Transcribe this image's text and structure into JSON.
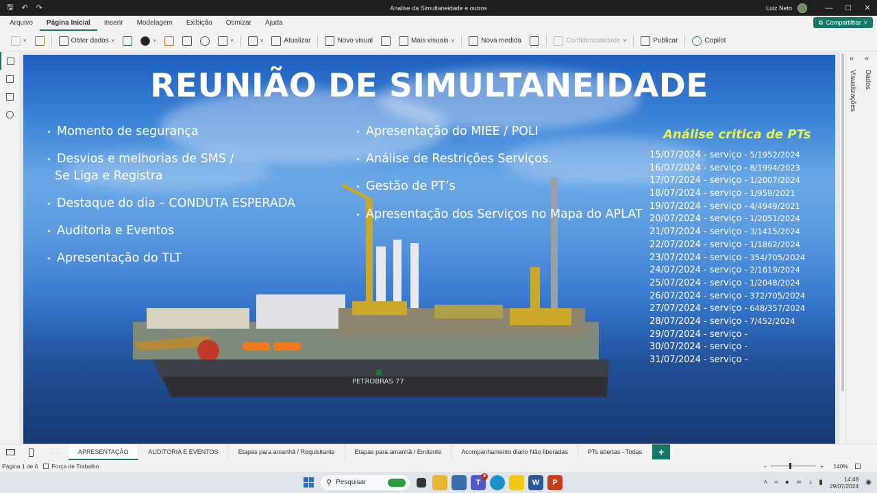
{
  "window": {
    "title": "Analise da Simultaneidade e outros",
    "user": "Luiz Neto",
    "controls": [
      "—",
      "☐",
      "✕"
    ]
  },
  "ribbon": {
    "tabs": [
      "Arquivo",
      "Página Inicial",
      "Inserir",
      "Modelagem",
      "Exibição",
      "Otimizar",
      "Ajuda"
    ],
    "active_tab": "Página Inicial",
    "share_label": "Compartilhar"
  },
  "toolbar": {
    "get_data": "Obter dados",
    "refresh": "Atualizar",
    "new_visual": "Novo visual",
    "more_visuals": "Mais visuais",
    "new_measure": "Nova medida",
    "sensitivity": "Confidencialidade",
    "publish": "Publicar",
    "copilot": "Copilot"
  },
  "right_panes": {
    "visualizations": "Visualizações",
    "data": "Dados"
  },
  "slide": {
    "title": "REUNIÃO DE SIMULTANEIDADE",
    "left_agenda": [
      "Momento de segurança",
      "Desvios e melhorias de SMS /",
      "Se Liga e Registra",
      "Destaque do dia – CONDUTA ESPERADA",
      "Auditoria e Eventos",
      "Apresentação do TLT"
    ],
    "middle_agenda": [
      "Apresentação do MIEE / POLI",
      "Análise de Restrições Serviços.",
      "Gestão de PT’s",
      "Apresentação dos Serviços no Mapa do APLAT"
    ],
    "pts_title": "Análise critica de PTs",
    "pts": [
      {
        "date": "15/07/2024 - serviço -",
        "num": "5/1952/2024"
      },
      {
        "date": "16/07/2024 - serviço -",
        "num": "8/1994/2023"
      },
      {
        "date": "17/07/2024 - serviço -",
        "num": "1/2007/2024"
      },
      {
        "date": "18/07/2024 - serviço -",
        "num": "1/959/2021"
      },
      {
        "date": "19/07/2024 - serviço -",
        "num": "4/4949/2021"
      },
      {
        "date": "20/07/2024 - serviço -",
        "num": "1/2051/2024"
      },
      {
        "date": "21/07/2024 - serviço -",
        "num": "3/1415/2024"
      },
      {
        "date": "22/07/2024 - serviço -",
        "num": "1/1862/2024"
      },
      {
        "date": "23/07/2024 - serviço -",
        "num": "354/705/2024"
      },
      {
        "date": "24/07/2024 - serviço -",
        "num": "2/1619/2024"
      },
      {
        "date": "25/07/2024 - serviço -",
        "num": "1/2048/2024"
      },
      {
        "date": "26/07/2024 - serviço -",
        "num": "372/705/2024"
      },
      {
        "date": "27/07/2024 - serviço -",
        "num": "648/357/2024"
      },
      {
        "date": "28/07/2024 - serviço -",
        "num": "7/452/2024"
      },
      {
        "date": "29/07/2024 - serviço -",
        "num": ""
      },
      {
        "date": "30/07/2024 - serviço -",
        "num": ""
      },
      {
        "date": "31/07/2024 - serviço -",
        "num": ""
      }
    ],
    "ship_label": "PETROBRAS 77"
  },
  "page_tabs": {
    "tabs": [
      "APRESENTAÇÃO",
      "AUDITORIA E EVENTOS",
      "Etapas para amanhã / Requisitante",
      "Etapas para amanhã / Emitente",
      "Acompanhamento diario Não liberadas",
      "PTs abertas - Todas"
    ],
    "active": "APRESENTAÇÃO",
    "add": "+"
  },
  "status": {
    "page": "Página 1 de 6",
    "workspace": "Força de Trabalho",
    "zoom": "140%",
    "zoom_fraction": 0.4
  },
  "taskbar": {
    "search_placeholder": "Pesquisar",
    "time": "14:48",
    "date": "29/07/2024",
    "teams_badge": "3"
  }
}
